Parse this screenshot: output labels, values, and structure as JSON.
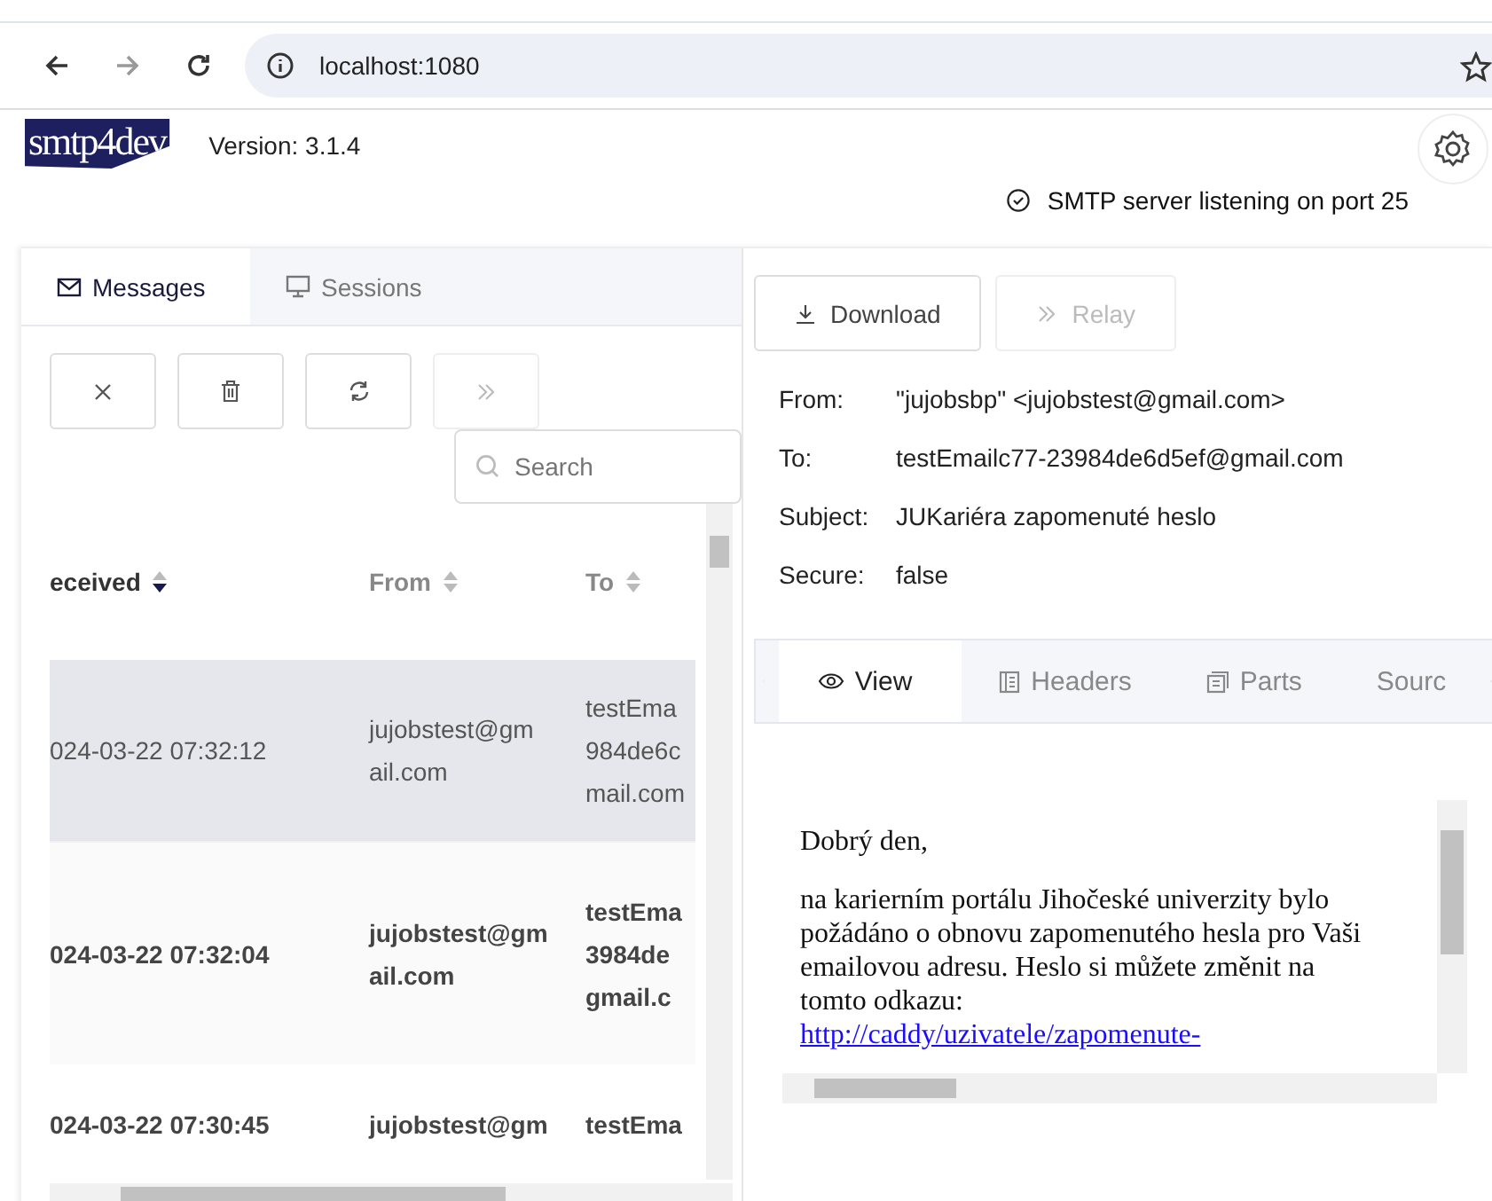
{
  "browser": {
    "url": "localhost:1080"
  },
  "app": {
    "logo": "smtp4dev",
    "version": "Version: 3.1.4",
    "status": "SMTP server listening on port 25"
  },
  "tabs": [
    {
      "label": "Messages",
      "selected": true
    },
    {
      "label": "Sessions",
      "selected": false
    }
  ],
  "toolbar": [
    {
      "disabled": false
    },
    {
      "disabled": false
    },
    {
      "disabled": false
    },
    {
      "disabled": true
    }
  ],
  "search": {
    "placeholder": "Search"
  },
  "table": {
    "columns": [
      {
        "label": "eceived",
        "sorted": true
      },
      {
        "label": "From",
        "sorted": false
      },
      {
        "label": "To",
        "sorted": false
      }
    ],
    "rows": [
      {
        "selected": true,
        "unread": false,
        "received": "024-03-22 07:32:12",
        "from": [
          "jujobstest@gm",
          "ail.com"
        ],
        "to": [
          "testEma",
          "984de6c",
          "mail.com"
        ]
      },
      {
        "selected": false,
        "unread": true,
        "received": "024-03-22 07:32:04",
        "from": [
          "jujobstest@gm",
          "ail.com"
        ],
        "to": [
          "testEma",
          "3984de",
          "gmail.c"
        ]
      },
      {
        "selected": false,
        "unread": true,
        "received": "024-03-22 07:30:45",
        "from": [
          "jujobstest@gm"
        ],
        "to": [
          "testEma"
        ]
      }
    ]
  },
  "actions": [
    {
      "label": "Download",
      "disabled": false
    },
    {
      "label": "Relay",
      "disabled": true
    }
  ],
  "headers": [
    {
      "label": "From:",
      "value": "\"jujobsbp\" <jujobstest@gmail.com>"
    },
    {
      "label": "To:",
      "value": "testEmailc77-23984de6d5ef@gmail.com"
    },
    {
      "label": "Subject:",
      "value": "JUKariéra zapomenuté heslo"
    },
    {
      "label": "Secure:",
      "value": "false"
    }
  ],
  "view_tabs": [
    {
      "label": "View",
      "selected": true
    },
    {
      "label": "Headers",
      "selected": false
    },
    {
      "label": "Parts",
      "selected": false
    },
    {
      "label": "Sourc",
      "selected": false
    }
  ],
  "body": {
    "greeting": "Dobrý den,",
    "paragraph": "na karierním portálu Jihočeské univerzity bylo požádáno o obnovu zapomenutého hesla pro Vaši emailovou adresu. Heslo si můžete změnit na tomto odkazu:",
    "link": "http://caddy/uzivatele/zapomenute-"
  }
}
